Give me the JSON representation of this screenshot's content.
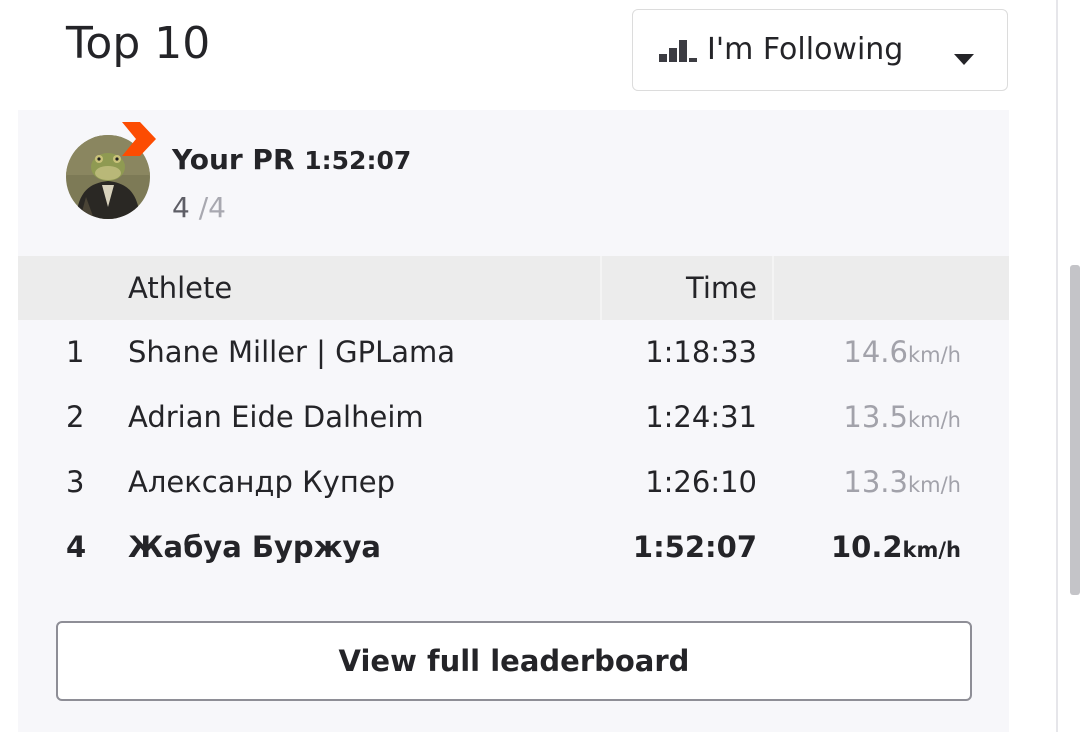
{
  "header": {
    "title": "Top 10",
    "filter": {
      "icon": "bar-chart-icon",
      "selected": "I'm Following"
    }
  },
  "pr": {
    "label": "Your PR",
    "time": "1:52:07",
    "rank": "4",
    "total": "/4",
    "avatar": "frog-avatar",
    "badge_icon": "pr-chevron-icon",
    "badge_color": "#fc4c02"
  },
  "table": {
    "headers": {
      "athlete": "Athlete",
      "time": "Time"
    },
    "rows": [
      {
        "rank": "1",
        "name": "Shane Miller | GPLama",
        "time": "1:18:33",
        "speed": "14.6",
        "unit": "km/h"
      },
      {
        "rank": "2",
        "name": "Adrian Eide Dalheim",
        "time": "1:24:31",
        "speed": "13.5",
        "unit": "km/h"
      },
      {
        "rank": "3",
        "name": "Александр Купер",
        "time": "1:26:10",
        "speed": "13.3",
        "unit": "km/h"
      },
      {
        "rank": "4",
        "name": "Жабуа Буржуа",
        "time": "1:52:07",
        "speed": "10.2",
        "unit": "km/h"
      }
    ]
  },
  "actions": {
    "view_full": "View full leaderboard"
  },
  "colors": {
    "accent": "#fc4c02",
    "text": "#242428",
    "muted": "#a2a2aa",
    "header_bg": "#ececec"
  }
}
